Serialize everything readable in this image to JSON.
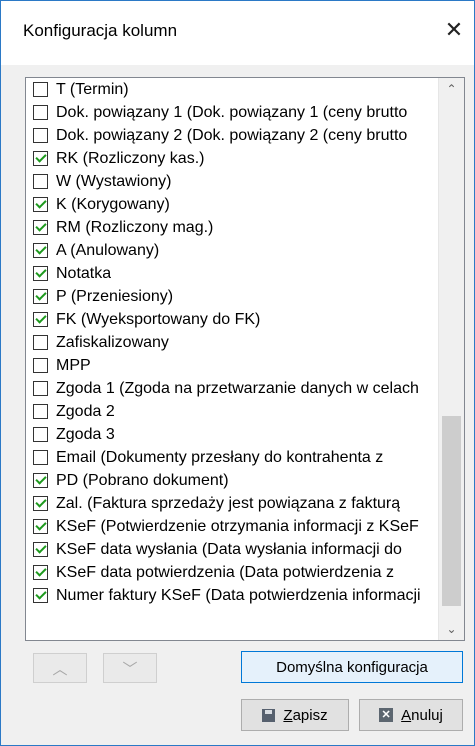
{
  "window": {
    "title": "Konfiguracja kolumn",
    "close_glyph": "✕"
  },
  "columns": [
    {
      "label": "T (Termin)",
      "checked": false
    },
    {
      "label": "Dok. powiązany 1 (Dok. powiązany 1 (ceny brutto",
      "checked": false
    },
    {
      "label": "Dok. powiązany 2 (Dok. powiązany 2 (ceny brutto",
      "checked": false
    },
    {
      "label": "RK (Rozliczony kas.)",
      "checked": true
    },
    {
      "label": "W (Wystawiony)",
      "checked": false
    },
    {
      "label": "K (Korygowany)",
      "checked": true
    },
    {
      "label": "RM (Rozliczony mag.)",
      "checked": true
    },
    {
      "label": "A (Anulowany)",
      "checked": true
    },
    {
      "label": "Notatka",
      "checked": true
    },
    {
      "label": "P (Przeniesiony)",
      "checked": true
    },
    {
      "label": "FK (Wyeksportowany do FK)",
      "checked": true
    },
    {
      "label": "Zafiskalizowany",
      "checked": false
    },
    {
      "label": "MPP",
      "checked": false
    },
    {
      "label": "Zgoda 1 (Zgoda na przetwarzanie danych w celach",
      "checked": false
    },
    {
      "label": "Zgoda 2",
      "checked": false
    },
    {
      "label": "Zgoda 3",
      "checked": false
    },
    {
      "label": "Email (Dokumenty przesłany do kontrahenta z",
      "checked": false
    },
    {
      "label": "PD (Pobrano dokument)",
      "checked": true
    },
    {
      "label": "Zal. (Faktura sprzedaży jest powiązana z fakturą",
      "checked": true
    },
    {
      "label": "KSeF (Potwierdzenie otrzymania informacji z KSeF",
      "checked": true
    },
    {
      "label": "KSeF data wysłania (Data wysłania informacji do",
      "checked": true
    },
    {
      "label": "KSeF data potwierdzenia (Data potwierdzenia z",
      "checked": true
    },
    {
      "label": "Numer faktury KSeF (Data potwierdzenia informacji",
      "checked": true
    }
  ],
  "scrollbar": {
    "up_glyph": "⌃",
    "down_glyph": "⌄",
    "scroll_position": 0.95
  },
  "buttons": {
    "move_up_glyph": "︿",
    "move_down_glyph": "﹀",
    "default_config": "Domyślna konfiguracja",
    "save_label": "Zapisz",
    "cancel_label": "Anuluj",
    "save_icon": "floppy-disk-icon",
    "cancel_icon": "cancel-x-icon"
  }
}
